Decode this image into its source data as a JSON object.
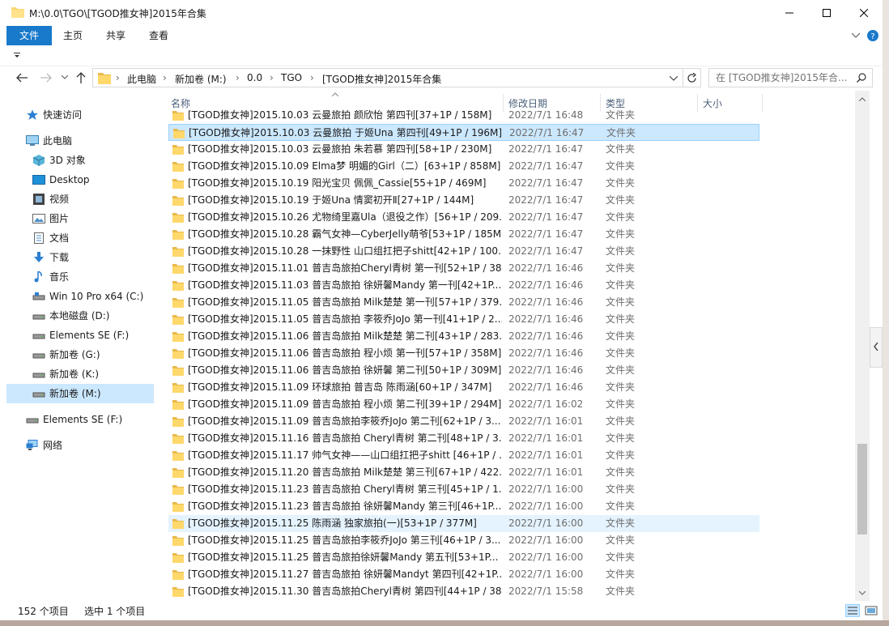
{
  "window": {
    "title": "M:\\0.0\\TGO\\[TGOD推女神]2015年合集"
  },
  "ribbon": {
    "tabs": [
      "文件",
      "主页",
      "共享",
      "查看"
    ]
  },
  "address": {
    "crumbs": [
      "此电脑",
      "新加卷 (M:)",
      "0.0",
      "TGO",
      "[TGOD推女神]2015年合集"
    ],
    "search_placeholder": "在 [TGOD推女神]2015年合..."
  },
  "nav": [
    {
      "label": "快速访问",
      "icon": "star-icon"
    },
    {
      "label": "此电脑",
      "icon": "computer-icon"
    },
    {
      "label": "3D 对象",
      "icon": "cube-icon"
    },
    {
      "label": "Desktop",
      "icon": "desktop-icon"
    },
    {
      "label": "视频",
      "icon": "video-icon"
    },
    {
      "label": "图片",
      "icon": "picture-icon"
    },
    {
      "label": "文档",
      "icon": "document-icon"
    },
    {
      "label": "下载",
      "icon": "download-icon"
    },
    {
      "label": "音乐",
      "icon": "music-icon"
    },
    {
      "label": "Win 10 Pro x64 (C:)",
      "icon": "drive-icon"
    },
    {
      "label": "本地磁盘 (D:)",
      "icon": "drive-icon"
    },
    {
      "label": "Elements SE (F:)",
      "icon": "drive-icon"
    },
    {
      "label": "新加卷 (G:)",
      "icon": "drive-icon"
    },
    {
      "label": "新加卷 (K:)",
      "icon": "drive-icon"
    },
    {
      "label": "新加卷 (M:)",
      "icon": "drive-icon"
    },
    {
      "label": "Elements SE (F:)",
      "icon": "drive-icon"
    },
    {
      "label": "网络",
      "icon": "network-icon"
    }
  ],
  "columns": {
    "name": "名称",
    "date": "修改日期",
    "type": "类型",
    "size": "大小"
  },
  "files": [
    {
      "name": "[TGOD推女神]2015.10.03 云曼旅拍 颜欣怡 第四刊[37+1P / 158M]",
      "date": "2022/7/1 16:48",
      "type": "文件夹"
    },
    {
      "name": "[TGOD推女神]2015.10.03 云曼旅拍 于姬Una 第四刊[49+1P / 196M]",
      "date": "2022/7/1 16:47",
      "type": "文件夹"
    },
    {
      "name": "[TGOD推女神]2015.10.03 云曼旅拍 朱若慕 第四刊[58+1P / 230M]",
      "date": "2022/7/1 16:47",
      "type": "文件夹"
    },
    {
      "name": "[TGOD推女神]2015.10.09 Elma梦 明媚的Girl（二）[63+1P / 858M]",
      "date": "2022/7/1 16:47",
      "type": "文件夹"
    },
    {
      "name": "[TGOD推女神]2015.10.19 阳光宝贝 佩佩_Cassie[55+1P / 469M]",
      "date": "2022/7/1 16:47",
      "type": "文件夹"
    },
    {
      "name": "[TGOD推女神]2015.10.19 于姬Una 情窦初开Ⅱ[27+1P / 144M]",
      "date": "2022/7/1 16:47",
      "type": "文件夹"
    },
    {
      "name": "[TGOD推女神]2015.10.26 尤物绮里嘉Ula（退役之作）[56+1P / 209...",
      "date": "2022/7/1 16:47",
      "type": "文件夹"
    },
    {
      "name": "[TGOD推女神]2015.10.28 霸气女神—CyberJelly萌爷[53+1P / 185M]",
      "date": "2022/7/1 16:47",
      "type": "文件夹"
    },
    {
      "name": "[TGOD推女神]2015.10.28 一抹野性 山口组扛把子shitt[42+1P / 100...",
      "date": "2022/7/1 16:47",
      "type": "文件夹"
    },
    {
      "name": "[TGOD推女神]2015.11.01 普吉岛旅拍Cheryl青树 第一刊[52+1P / 38...",
      "date": "2022/7/1 16:46",
      "type": "文件夹"
    },
    {
      "name": "[TGOD推女神]2015.11.03 普吉岛旅拍 徐妍馨Mandy 第一刊[42+1P...",
      "date": "2022/7/1 16:46",
      "type": "文件夹"
    },
    {
      "name": "[TGOD推女神]2015.11.05 普吉岛旅拍 Milk楚楚 第一刊[57+1P / 379...",
      "date": "2022/7/1 16:46",
      "type": "文件夹"
    },
    {
      "name": "[TGOD推女神]2015.11.05 普吉岛旅拍 李筱乔JoJo 第一刊[41+1P / 2...",
      "date": "2022/7/1 16:46",
      "type": "文件夹"
    },
    {
      "name": "[TGOD推女神]2015.11.06 普吉岛旅拍 Milk楚楚 第二刊[43+1P / 283...",
      "date": "2022/7/1 16:46",
      "type": "文件夹"
    },
    {
      "name": "[TGOD推女神]2015.11.06 普吉岛旅拍 程小烦 第一刊[57+1P / 358M]",
      "date": "2022/7/1 16:46",
      "type": "文件夹"
    },
    {
      "name": "[TGOD推女神]2015.11.06 普吉岛旅拍 徐妍馨 第二刊[50+1P / 309M]",
      "date": "2022/7/1 16:46",
      "type": "文件夹"
    },
    {
      "name": "[TGOD推女神]2015.11.09 环球旅拍 普吉岛 陈雨涵[60+1P / 347M]",
      "date": "2022/7/1 16:46",
      "type": "文件夹"
    },
    {
      "name": "[TGOD推女神]2015.11.09 普吉岛旅拍 程小烦 第二刊[39+1P / 294M]",
      "date": "2022/7/1 16:02",
      "type": "文件夹"
    },
    {
      "name": "[TGOD推女神]2015.11.09 普吉岛旅拍李筱乔JoJo 第二刊[62+1P / 3...",
      "date": "2022/7/1 16:01",
      "type": "文件夹"
    },
    {
      "name": "[TGOD推女神]2015.11.16 普吉岛旅拍 Cheryl青树 第二刊[48+1P / 3...",
      "date": "2022/7/1 16:01",
      "type": "文件夹"
    },
    {
      "name": "[TGOD推女神]2015.11.17 帅气女神——山口组扛把子shitt [46+1P / ...",
      "date": "2022/7/1 16:01",
      "type": "文件夹"
    },
    {
      "name": "[TGOD推女神]2015.11.20 普吉岛旅拍 Milk楚楚 第三刊[67+1P / 422...",
      "date": "2022/7/1 16:01",
      "type": "文件夹"
    },
    {
      "name": "[TGOD推女神]2015.11.23 普吉岛旅拍 Cheryl青树 第三刊[45+1P / 1...",
      "date": "2022/7/1 16:00",
      "type": "文件夹"
    },
    {
      "name": "[TGOD推女神]2015.11.23 普吉岛旅拍 徐妍馨Mandy 第三刊[46+1P...",
      "date": "2022/7/1 16:00",
      "type": "文件夹"
    },
    {
      "name": "[TGOD推女神]2015.11.25 陈雨涵 独家旅拍(一)[53+1P / 377M]",
      "date": "2022/7/1 16:00",
      "type": "文件夹"
    },
    {
      "name": "[TGOD推女神]2015.11.25 普吉岛旅拍李筱乔JoJo 第三刊[46+1P / 3...",
      "date": "2022/7/1 16:00",
      "type": "文件夹"
    },
    {
      "name": "[TGOD推女神]2015.11.25 普吉岛旅拍徐妍馨Mandy 第五刊[53+1P...",
      "date": "2022/7/1 16:00",
      "type": "文件夹"
    },
    {
      "name": "[TGOD推女神]2015.11.27 普吉岛旅拍 徐妍馨Mandyt 第四刊[42+1P...",
      "date": "2022/7/1 16:00",
      "type": "文件夹"
    },
    {
      "name": "[TGOD推女神]2015.11.30 普吉岛旅拍Cheryl青树 第四刊[44+1P / 38...",
      "date": "2022/7/1 15:58",
      "type": "文件夹"
    }
  ],
  "status": {
    "count": "152 个项目",
    "selected": "选中 1 个项目"
  },
  "colors": {
    "accent": "#1979ca",
    "selected": "#cce8ff",
    "folder": "#f8d775"
  }
}
